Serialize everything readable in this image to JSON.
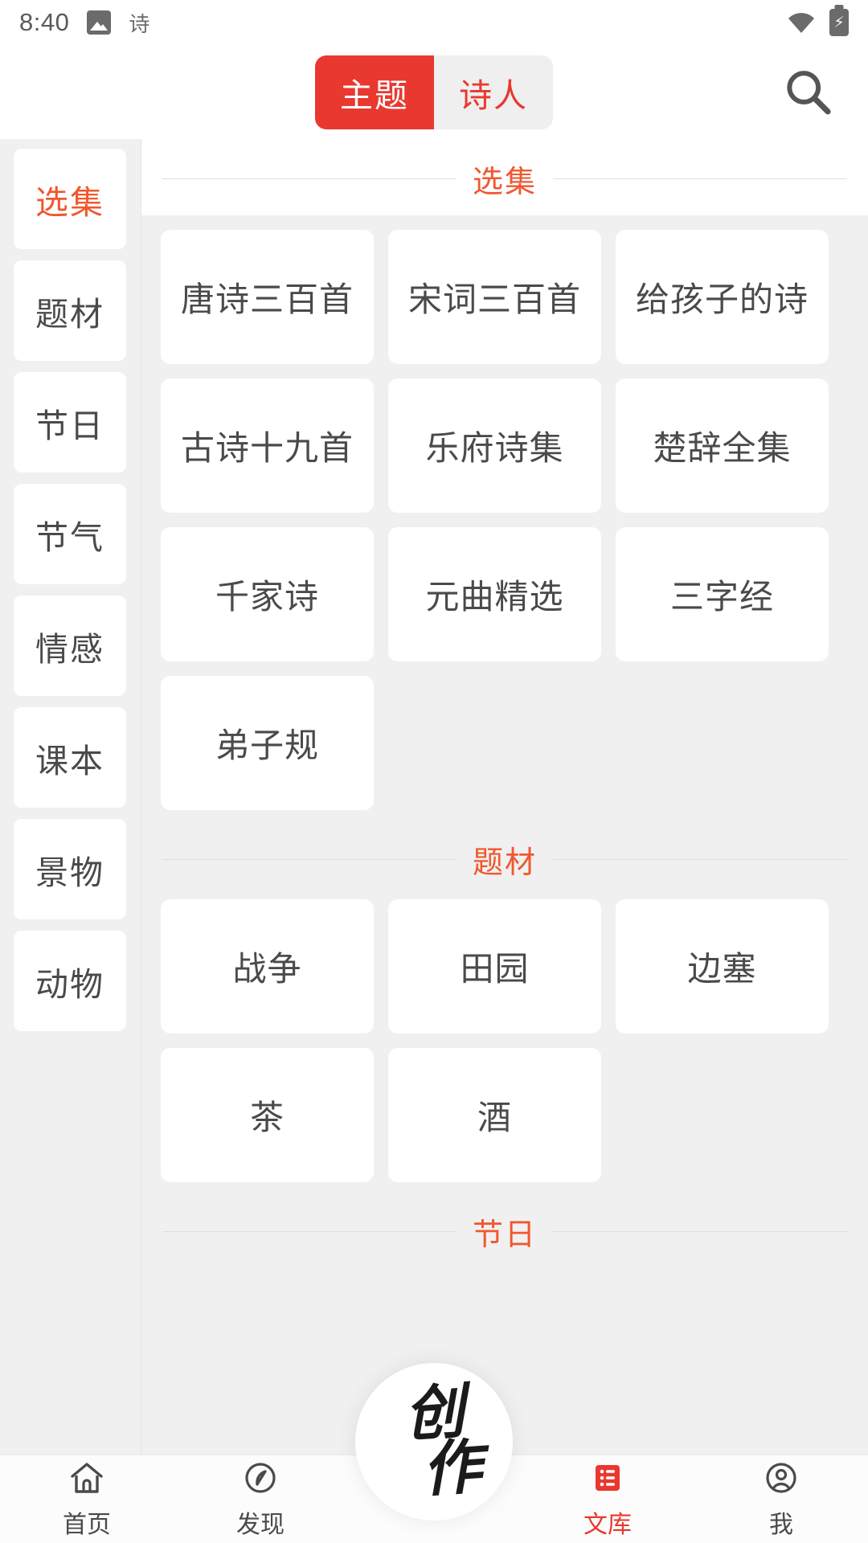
{
  "status_bar": {
    "time": "8:40",
    "image_icon": "image-icon",
    "notification_text": "诗",
    "wifi_icon": "wifi-icon",
    "battery_icon": "battery-charging-icon",
    "battery_glyph": "⚡"
  },
  "top_bar": {
    "tabs": [
      {
        "label": "主题",
        "active": true
      },
      {
        "label": "诗人",
        "active": false
      }
    ],
    "search_icon": "search-icon",
    "active_tab_color": "#E8382F",
    "inactive_tab_bg": "#efefef"
  },
  "sidebar": {
    "items": [
      {
        "label": "选集",
        "active": true
      },
      {
        "label": "题材",
        "active": false
      },
      {
        "label": "节日",
        "active": false
      },
      {
        "label": "节气",
        "active": false
      },
      {
        "label": "情感",
        "active": false
      },
      {
        "label": "课本",
        "active": false
      },
      {
        "label": "景物",
        "active": false
      },
      {
        "label": "动物",
        "active": false
      }
    ],
    "active_color": "#F0582F"
  },
  "content": {
    "sections": [
      {
        "title": "选集",
        "on_white": true,
        "items": [
          "唐诗三百首",
          "宋词三百首",
          "给孩子的诗",
          "古诗十九首",
          "乐府诗集",
          "楚辞全集",
          "千家诗",
          "元曲精选",
          "三字经",
          "弟子规"
        ]
      },
      {
        "title": "题材",
        "on_white": false,
        "items": [
          "战争",
          "田园",
          "边塞",
          "茶",
          "酒"
        ]
      },
      {
        "title": "节日",
        "on_white": false,
        "items": []
      }
    ],
    "section_title_color": "#F0582F"
  },
  "fab": {
    "char1": "创",
    "char2": "作",
    "name": "create-button"
  },
  "bottom_nav": {
    "items": [
      {
        "label": "首页",
        "icon": "home-icon",
        "active": false
      },
      {
        "label": "发现",
        "icon": "compass-icon",
        "active": false
      },
      {
        "label": "文库",
        "icon": "library-list-icon",
        "active": true
      },
      {
        "label": "我",
        "icon": "person-icon",
        "active": false
      }
    ],
    "active_color": "#E8382F"
  }
}
